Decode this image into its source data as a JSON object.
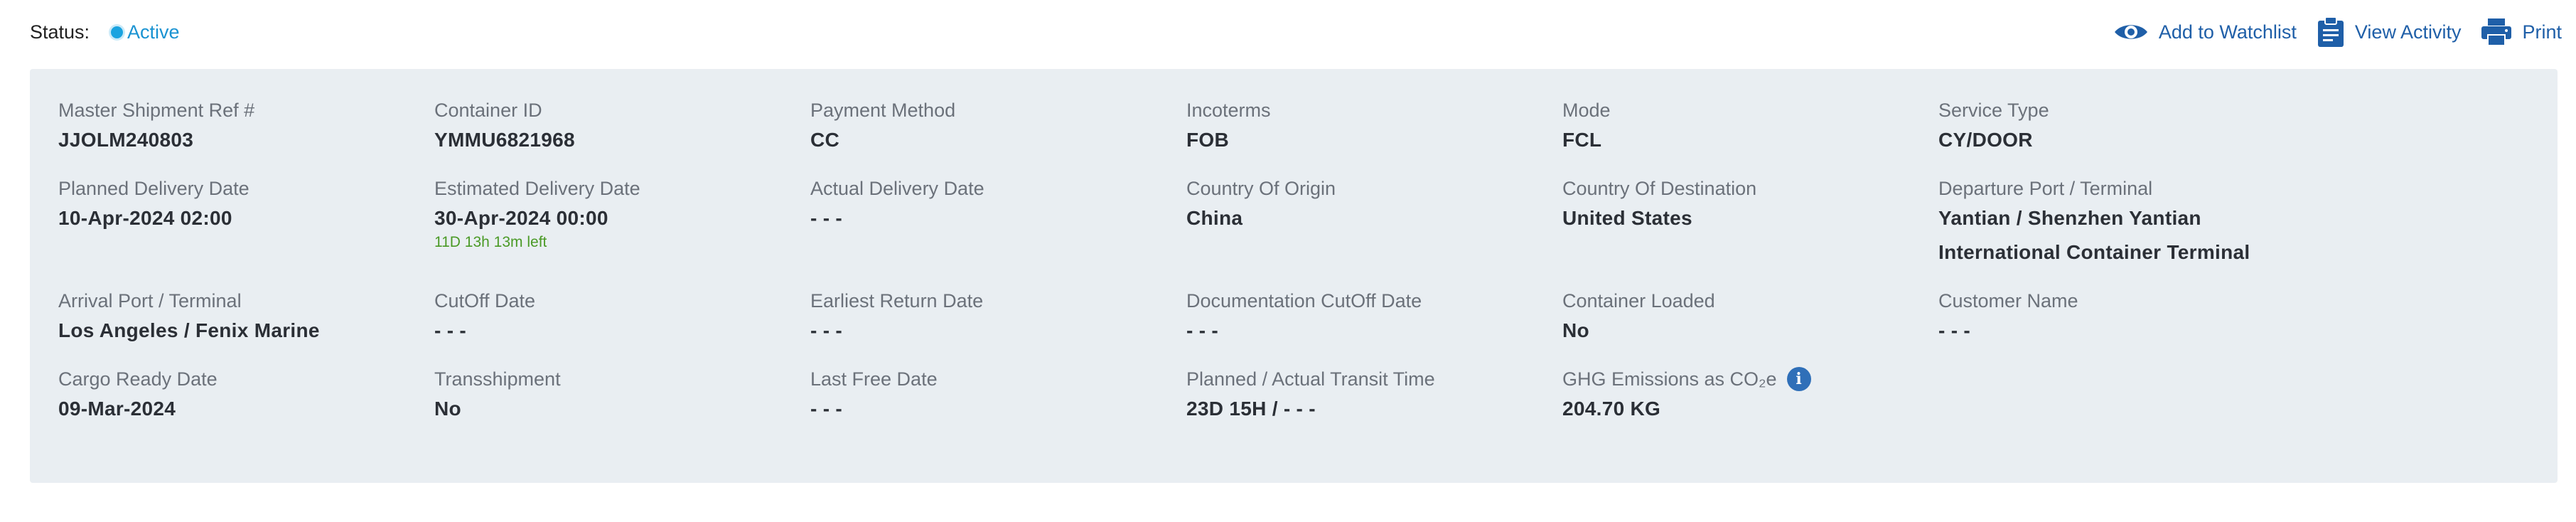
{
  "status": {
    "label": "Status:",
    "value": "Active"
  },
  "actions": {
    "watchlist": {
      "label": "Add to Watchlist",
      "icon": "eye-icon"
    },
    "activity": {
      "label": "View Activity",
      "icon": "clipboard-icon"
    },
    "print": {
      "label": "Print",
      "icon": "printer-icon"
    }
  },
  "colors": {
    "accent": "#1f5fa8",
    "status": "#1aa3e0",
    "panel_bg": "#e9eef2",
    "note": "#4a9a26"
  },
  "rows": [
    [
      {
        "label": "Master Shipment Ref #",
        "value": "JJOLM240803"
      },
      {
        "label": "Container ID",
        "value": "YMMU6821968"
      },
      {
        "label": "Payment Method",
        "value": "CC"
      },
      {
        "label": "Incoterms",
        "value": "FOB"
      },
      {
        "label": "Mode",
        "value": "FCL"
      },
      {
        "label": "Service Type",
        "value": "CY/DOOR"
      }
    ],
    [
      {
        "label": "Planned Delivery Date",
        "value": "10-Apr-2024 02:00"
      },
      {
        "label": "Estimated Delivery Date",
        "value": "30-Apr-2024 00:00",
        "note": "11D 13h 13m left"
      },
      {
        "label": "Actual Delivery Date",
        "value": "- - -"
      },
      {
        "label": "Country Of Origin",
        "value": "China"
      },
      {
        "label": "Country Of Destination",
        "value": "United States"
      },
      {
        "label": "Departure Port / Terminal",
        "value": "Yantian / Shenzhen Yantian\nInternational Container Terminal"
      }
    ],
    [
      {
        "label": "Arrival Port / Terminal",
        "value": "Los Angeles / Fenix Marine"
      },
      {
        "label": "CutOff Date",
        "value": "- - -"
      },
      {
        "label": "Earliest Return Date",
        "value": "- - -"
      },
      {
        "label": "Documentation CutOff Date",
        "value": "- - -"
      },
      {
        "label": "Container Loaded",
        "value": "No"
      },
      {
        "label": "Customer Name",
        "value": "- - -"
      }
    ],
    [
      {
        "label": "Cargo Ready Date",
        "value": "09-Mar-2024"
      },
      {
        "label": "Transshipment",
        "value": "No"
      },
      {
        "label": "Last Free Date",
        "value": "- - -"
      },
      {
        "label": "Planned / Actual Transit Time",
        "value": "23D 15H / - - -"
      },
      {
        "label": "GHG Emissions as CO₂e",
        "value": "204.70 KG",
        "info": "info-icon"
      }
    ]
  ]
}
